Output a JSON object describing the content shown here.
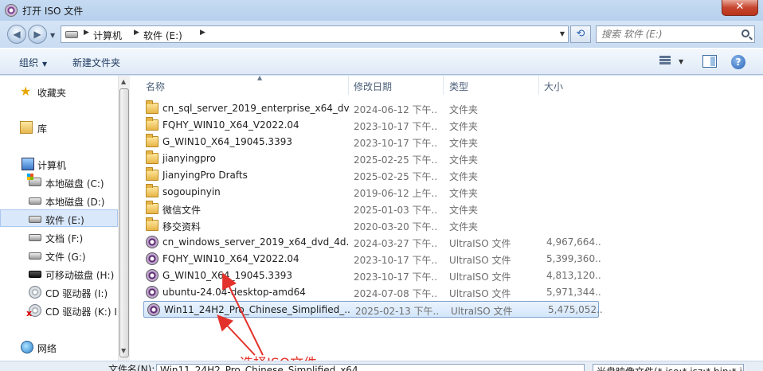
{
  "window": {
    "title": "打开 ISO 文件",
    "close_glyph": "✕"
  },
  "navigation": {
    "back_glyph": "◀",
    "forward_glyph": "▶",
    "breadcrumb": [
      "计算机",
      "软件 (E:)"
    ],
    "refresh_glyph": "⟲",
    "search_placeholder": "搜索 软件 (E:)"
  },
  "toolbar": {
    "organize": "组织",
    "new_folder": "新建文件夹",
    "help": "?"
  },
  "sidebar": {
    "favorites": "收藏夹",
    "libraries": "库",
    "computer": "计算机",
    "drives": [
      {
        "label": "本地磁盘 (C:)",
        "icon": "windows-drive-icon"
      },
      {
        "label": "本地磁盘 (D:)",
        "icon": "drive-icon"
      },
      {
        "label": "软件 (E:)",
        "icon": "drive-icon",
        "selected": true
      },
      {
        "label": "文档 (F:)",
        "icon": "drive-icon"
      },
      {
        "label": "文件 (G:)",
        "icon": "drive-icon"
      },
      {
        "label": "可移动磁盘 (H:)",
        "icon": "usb-drive-icon"
      },
      {
        "label": "CD 驱动器 (I:)",
        "icon": "cd-drive-icon"
      },
      {
        "label": "CD 驱动器 (K:) I",
        "icon": "cd-drive-error-icon"
      }
    ],
    "network": "网络"
  },
  "columns": {
    "name": "名称",
    "date": "修改日期",
    "type": "类型",
    "size": "大小"
  },
  "files": [
    {
      "name": "cn_sql_server_2019_enterprise_x64_dv...",
      "date": "2024-06-12 下午...",
      "type": "文件夹",
      "size": "",
      "kind": "folder"
    },
    {
      "name": "FQHY_WIN10_X64_V2022.04",
      "date": "2023-10-17 下午...",
      "type": "文件夹",
      "size": "",
      "kind": "folder"
    },
    {
      "name": "G_WIN10_X64_19045.3393",
      "date": "2023-10-17 下午...",
      "type": "文件夹",
      "size": "",
      "kind": "folder"
    },
    {
      "name": "jianyingpro",
      "date": "2025-02-25 下午...",
      "type": "文件夹",
      "size": "",
      "kind": "folder"
    },
    {
      "name": "JianyingPro Drafts",
      "date": "2025-02-25 下午...",
      "type": "文件夹",
      "size": "",
      "kind": "folder"
    },
    {
      "name": "sogoupinyin",
      "date": "2019-06-12 上午...",
      "type": "文件夹",
      "size": "",
      "kind": "folder"
    },
    {
      "name": "微信文件",
      "date": "2025-01-03 下午...",
      "type": "文件夹",
      "size": "",
      "kind": "folder"
    },
    {
      "name": "移交资料",
      "date": "2020-03-20 下午...",
      "type": "文件夹",
      "size": "",
      "kind": "folder"
    },
    {
      "name": "cn_windows_server_2019_x64_dvd_4d...",
      "date": "2024-03-27 下午...",
      "type": "UltraISO 文件",
      "size": "4,967,664...",
      "kind": "iso"
    },
    {
      "name": "FQHY_WIN10_X64_V2022.04",
      "date": "2023-10-17 下午...",
      "type": "UltraISO 文件",
      "size": "5,399,360...",
      "kind": "iso"
    },
    {
      "name": "G_WIN10_X64_19045.3393",
      "date": "2023-10-17 下午...",
      "type": "UltraISO 文件",
      "size": "4,813,120...",
      "kind": "iso"
    },
    {
      "name": "ubuntu-24.04-desktop-amd64",
      "date": "2024-07-08 下午...",
      "type": "UltraISO 文件",
      "size": "5,971,344...",
      "kind": "iso"
    },
    {
      "name": "Win11_24H2_Pro_Chinese_Simplified_...",
      "date": "2025-02-13 下午...",
      "type": "UltraISO 文件",
      "size": "5,475,052...",
      "kind": "iso",
      "selected": true
    }
  ],
  "annotation": {
    "text": "选择ISO文件",
    "color": "#e3322b"
  },
  "bottom": {
    "filename_label": "文件名(N):",
    "filename_value": "Win11_24H2_Pro_Chinese_Simplified_x64",
    "filter_value": "光盘映像文件(*.iso;*.isz;*.bin;*.img)"
  }
}
